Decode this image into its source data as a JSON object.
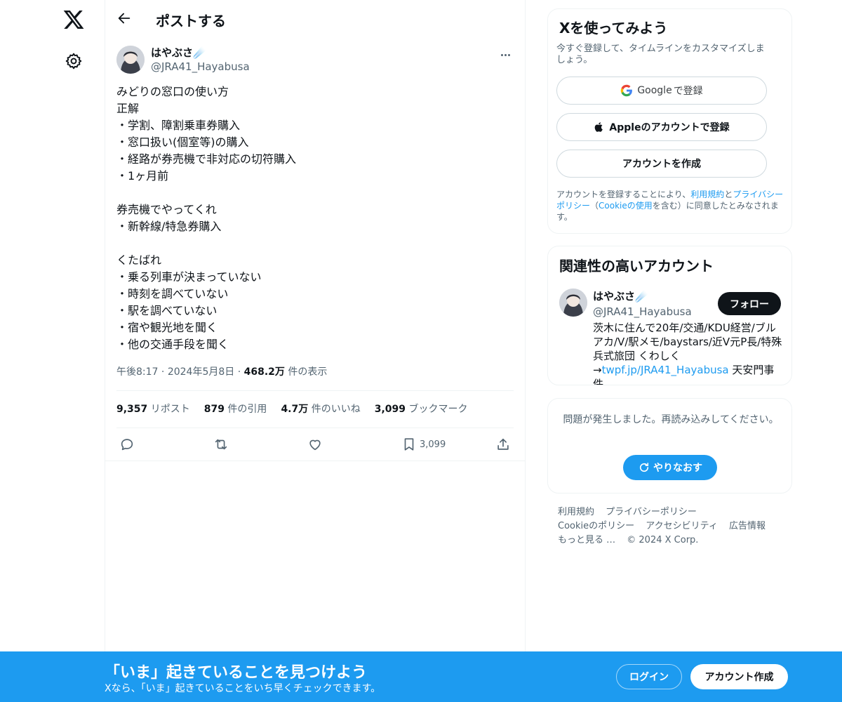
{
  "nav": {
    "logo_icon": "x-logo-icon",
    "settings_icon": "gear-icon"
  },
  "header": {
    "title": "ポストする",
    "back_icon": "back-arrow-icon"
  },
  "tweet": {
    "author_name": "はやぶさ",
    "author_emoji": "☄️",
    "author_handle": "@JRA41_Hayabusa",
    "text": "みどりの窓口の使い方\n正解\n・学割、障割乗車券購入\n・窓口扱い(個室等)の購入\n・経路が券売機で非対応の切符購入\n・1ヶ月前\n\n券売機でやってくれ\n・新幹線/特急券購入\n\nくたばれ\n・乗る列車が決まっていない\n・時刻を調べていない\n・駅を調べていない\n・宿や観光地を聞く\n・他の交通手段を聞く",
    "time": "午後8:17",
    "date": "2024年5月8日",
    "views_count": "468.2万",
    "views_label": " 件の表示",
    "stats": {
      "reposts_count": "9,357",
      "reposts_label": " リポスト",
      "quotes_count": "879",
      "quotes_label": " 件の引用",
      "likes_count": "4.7万",
      "likes_label": " 件のいいね",
      "bookmarks_count": "3,099",
      "bookmarks_label": " ブックマーク"
    },
    "bookmark_action_count": "3,099"
  },
  "signup_card": {
    "title": "Xを使ってみよう",
    "subtitle": "今すぐ登録して、タイムラインをカスタマイズしましょう。",
    "google_brand": "Google",
    "google_suffix": " で登録",
    "apple_button": "Appleのアカウントで登録",
    "create_button": "アカウントを作成",
    "legal_1": "アカウントを登録することにより、",
    "legal_terms": "利用規約",
    "legal_2": "と",
    "legal_privacy": "プライバシーポリシー",
    "legal_3": "（",
    "legal_cookie": "Cookieの使用",
    "legal_4": "を含む）に同意したとみなされます。"
  },
  "related_card": {
    "title": "関連性の高いアカウント",
    "name": "はやぶさ",
    "emoji": "☄️",
    "handle": "@JRA41_Hayabusa",
    "follow_button": "フォロー",
    "bio_text": "茨木に住んで20年/交通/KDU経営/ブルアカ/V/駅メモ/baystars/近V元P長/特殊兵式旅団 くわしく→",
    "bio_link": "twpf.jp/JRA41_Hayabusa",
    "bio_tail": " 天安門事件"
  },
  "error_card": {
    "message": "問題が発生しました。再読み込みしてください。",
    "retry_button": "やりなおす"
  },
  "footer": {
    "links": [
      "利用規約",
      "プライバシーポリシー",
      "Cookieのポリシー",
      "アクセシビリティ",
      "広告情報",
      "もっと見る …"
    ],
    "copyright": "© 2024 X Corp."
  },
  "banner": {
    "title": "「いま」起きていることを見つけよう",
    "subtitle": "Xなら、「いま」起きていることをいち早くチェックできます。",
    "login_button": "ログイン",
    "signup_button": "アカウント作成"
  },
  "colors": {
    "accent": "#1d9bf0",
    "text": "#0f1419",
    "secondary": "#536471",
    "border": "#eff3f4"
  }
}
